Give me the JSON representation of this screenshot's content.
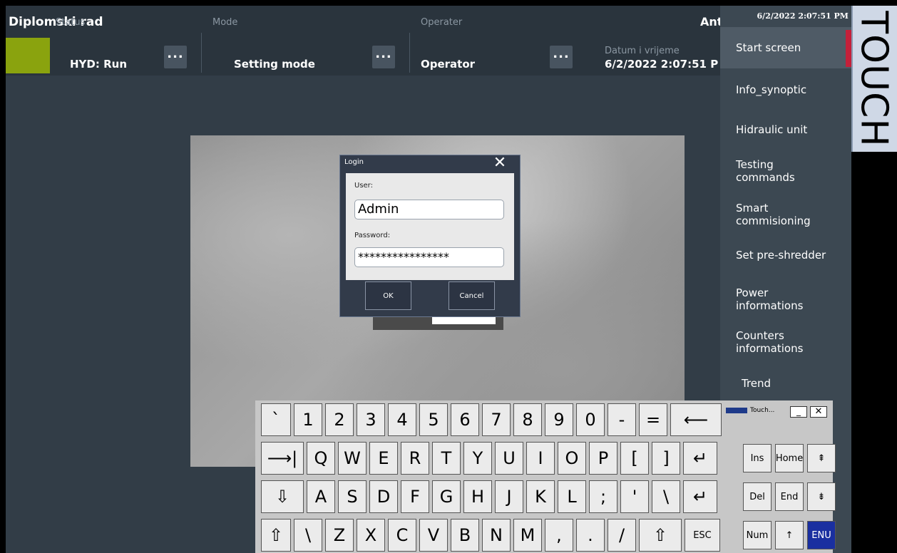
{
  "header": {
    "title": "Diplomski rad",
    "user": "Ant",
    "status": {
      "label": "Status",
      "value": "HYD: Run"
    },
    "mode": {
      "label": "Mode",
      "value": "Setting mode"
    },
    "operator": {
      "label": "Operater",
      "value": "Operator"
    },
    "datetime": {
      "label": "Datum i vrijeme",
      "value": "6/2/2022 2:07:51 P"
    },
    "more": "...",
    "status_color": "#8aa30e"
  },
  "nav": {
    "time": "6/2/2022 2:07:51 PM",
    "items": [
      "Start screen",
      "Info_synoptic",
      "Hidraulic unit",
      "Testing commands",
      "Smart commisioning",
      "Set pre-shredder",
      "Power informations",
      "Counters informations",
      "Trend"
    ],
    "active": "Start screen",
    "accent": "#c4203a"
  },
  "touch_label": "TOUCH",
  "login": {
    "title": "Login",
    "close": "✕",
    "user_label": "User:",
    "user_value": "Admin",
    "password_label": "Password:",
    "password_value": "****************",
    "ok": "OK",
    "cancel": "Cancel"
  },
  "keyboard": {
    "row1": [
      "`",
      "1",
      "2",
      "3",
      "4",
      "5",
      "6",
      "7",
      "8",
      "9",
      "0",
      "-",
      "=",
      "⟵"
    ],
    "row2": [
      "⟶|",
      "Q",
      "W",
      "E",
      "R",
      "T",
      "Y",
      "U",
      "I",
      "O",
      "P",
      "[",
      "]",
      "↵"
    ],
    "row3": [
      "⇩",
      "A",
      "S",
      "D",
      "F",
      "G",
      "H",
      "J",
      "K",
      "L",
      ";",
      "'",
      "\\",
      "↵"
    ],
    "row4": [
      "⇧",
      "\\",
      "Z",
      "X",
      "C",
      "V",
      "B",
      "N",
      "M",
      ",",
      ".",
      "/",
      "⇧",
      "ESC"
    ],
    "panel_title": "Touch...",
    "panel": [
      "Ins",
      "Home",
      "⇞",
      "Del",
      "End",
      "⇟",
      "Num",
      "↑",
      "ENU"
    ]
  }
}
